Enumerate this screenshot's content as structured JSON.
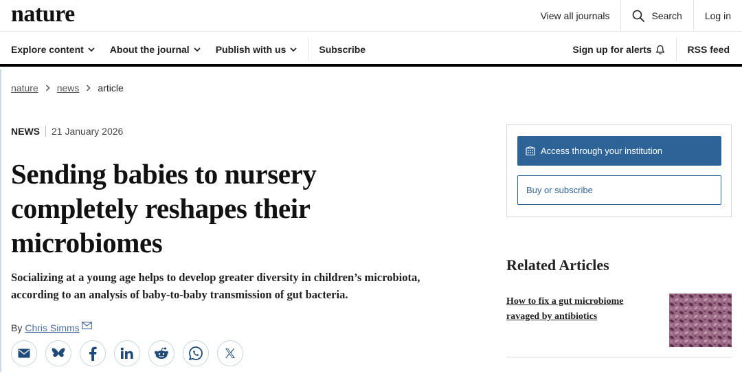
{
  "header": {
    "logo": "nature",
    "links": {
      "view_all_journals": "View all journals",
      "search": "Search",
      "log_in": "Log in"
    }
  },
  "nav": {
    "explore": "Explore content",
    "about": "About the journal",
    "publish": "Publish with us",
    "subscribe": "Subscribe",
    "sign_up_alerts": "Sign up for alerts",
    "rss": "RSS feed"
  },
  "breadcrumb": {
    "items": [
      "nature",
      "news"
    ],
    "current": "article"
  },
  "article": {
    "type": "NEWS",
    "date": "21 January 2026",
    "headline": "Sending babies to nursery completely reshapes their microbiomes",
    "standfirst": "Socializing at a young age helps to develop greater diversity in children’s microbiota, according to an analysis of baby-to-baby transmission of gut bacteria.",
    "by_prefix": "By",
    "author": "Chris Simms"
  },
  "share": {
    "icons": [
      "email-icon",
      "bluesky-icon",
      "facebook-icon",
      "linkedin-icon",
      "reddit-icon",
      "whatsapp-icon",
      "x-icon"
    ]
  },
  "sidebar": {
    "access_button": "Access through your institution",
    "buy_button": "Buy or subscribe",
    "related_title": "Related Articles",
    "related": [
      {
        "title": "How to fix a gut microbiome ravaged by antibiotics"
      }
    ]
  },
  "colors": {
    "accent": "#2e6398",
    "author_link": "#4a6fa5",
    "rule": "#000000"
  }
}
